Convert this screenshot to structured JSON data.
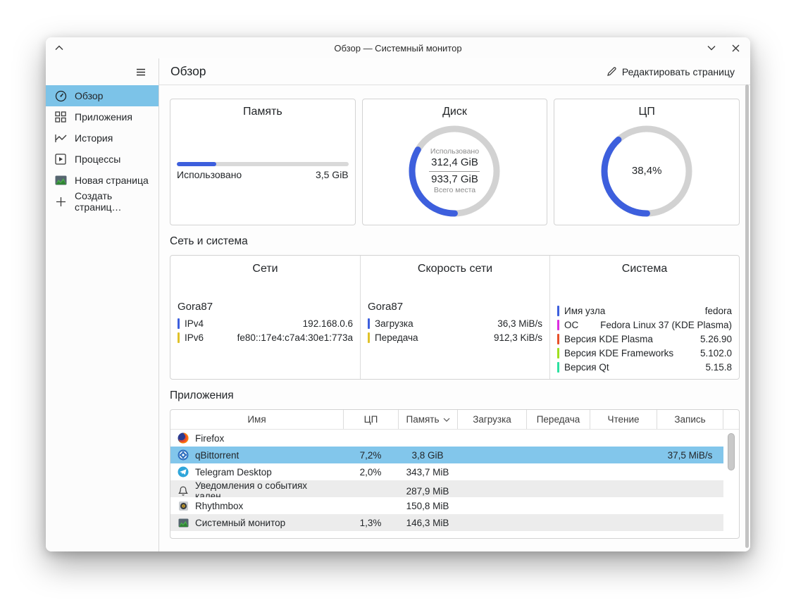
{
  "window": {
    "title": "Обзор — Системный монитор",
    "controls": {
      "shade": "chevron-up",
      "minimize": "chevron-down",
      "close": "close"
    }
  },
  "toolbar": {
    "page_title": "Обзор",
    "edit_button_label": "Редактировать страницу"
  },
  "sidebar": {
    "items": [
      {
        "label": "Обзор",
        "icon": "gauge-icon",
        "selected": true
      },
      {
        "label": "Приложения",
        "icon": "grid-icon",
        "selected": false
      },
      {
        "label": "История",
        "icon": "history-chart-icon",
        "selected": false
      },
      {
        "label": "Процессы",
        "icon": "processes-icon",
        "selected": false
      },
      {
        "label": "Новая страница",
        "icon": "page-thumbnail-icon",
        "selected": false
      },
      {
        "label": "Создать страниц…",
        "icon": "plus-icon",
        "selected": false
      }
    ]
  },
  "cards": {
    "memory": {
      "title": "Память",
      "used_label": "Использовано",
      "used_value": "3,5 GiB",
      "percent": 23
    },
    "disk": {
      "title": "Диск",
      "center_top": "Использовано",
      "used": "312,4 GiB",
      "total": "933,7 GiB",
      "center_bottom": "Всего места",
      "percent": 33.5
    },
    "cpu": {
      "title": "ЦП",
      "value": "38,4%",
      "percent": 38.4
    }
  },
  "accent": {
    "chart_blue": "#3d5fdd",
    "selection_blue": "#82c6eb",
    "sidebar_selection": "#7cc3e8"
  },
  "network_section": {
    "title": "Сеть и система",
    "networks": {
      "title": "Сети",
      "group": "Gora87",
      "rows": [
        {
          "label": "IPv4",
          "value": "192.168.0.6",
          "color": "#3d5fdd"
        },
        {
          "label": "IPv6",
          "value": "fe80::17e4:c7a4:30e1:773a",
          "color": "#e0c229"
        }
      ]
    },
    "speed": {
      "title": "Скорость сети",
      "group": "Gora87",
      "rows": [
        {
          "label": "Загрузка",
          "value": "36,3 MiB/s",
          "color": "#3d5fdd"
        },
        {
          "label": "Передача",
          "value": "912,3 KiB/s",
          "color": "#e0c229"
        }
      ]
    },
    "system": {
      "title": "Система",
      "rows": [
        {
          "label": "Имя узла",
          "value": "fedora",
          "color": "#3d5fdd"
        },
        {
          "label": "ОС",
          "value": "Fedora Linux 37 (KDE Plasma)",
          "color": "#dc2ee0"
        },
        {
          "label": "Версия KDE Plasma",
          "value": "5.26.90",
          "color": "#e8502a"
        },
        {
          "label": "Версия KDE Frameworks",
          "value": "5.102.0",
          "color": "#9fdf20"
        },
        {
          "label": "Версия Qt",
          "value": "5.15.8",
          "color": "#2ce0a0"
        }
      ]
    }
  },
  "apps_section": {
    "title": "Приложения",
    "columns": [
      "Имя",
      "ЦП",
      "Память",
      "Загрузка",
      "Передача",
      "Чтение",
      "Запись"
    ],
    "sort_column": "Память",
    "rows": [
      {
        "name": "Firefox",
        "cpu": "",
        "memory": "",
        "download": "",
        "upload": "",
        "read": "",
        "write": "",
        "icon": "firefox-icon"
      },
      {
        "name": "qBittorrent",
        "cpu": "7,2%",
        "memory": "3,8 GiB",
        "download": "",
        "upload": "",
        "read": "",
        "write": "37,5 MiB/s",
        "icon": "qbittorrent-icon"
      },
      {
        "name": "Telegram Desktop",
        "cpu": "2,0%",
        "memory": "343,7 MiB",
        "download": "",
        "upload": "",
        "read": "",
        "write": "",
        "icon": "telegram-icon"
      },
      {
        "name": "Уведомления о событиях кален…",
        "cpu": "",
        "memory": "287,9 MiB",
        "download": "",
        "upload": "",
        "read": "",
        "write": "",
        "icon": "bell-icon"
      },
      {
        "name": "Rhythmbox",
        "cpu": "",
        "memory": "150,8 MiB",
        "download": "",
        "upload": "",
        "read": "",
        "write": "",
        "icon": "rhythmbox-icon"
      },
      {
        "name": "Системный монитор",
        "cpu": "1,3%",
        "memory": "146,3 MiB",
        "download": "",
        "upload": "",
        "read": "",
        "write": "",
        "icon": "sysmon-icon"
      }
    ]
  }
}
